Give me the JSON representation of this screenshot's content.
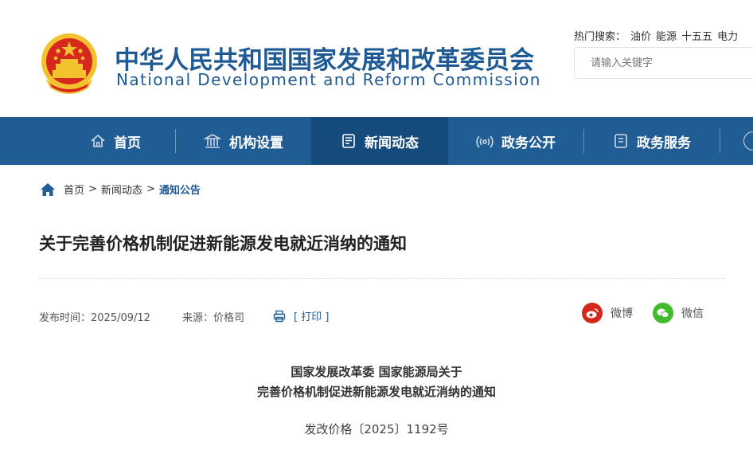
{
  "header": {
    "title_cn": "中华人民共和国国家发展和改革委员会",
    "title_en": "National Development and Reform Commission",
    "hot_search_label": "热门搜索：",
    "hot_keywords": [
      "油价",
      "能源",
      "十五五",
      "电力"
    ],
    "search_placeholder": "请输入关键字"
  },
  "nav": {
    "items": [
      {
        "label": "首页",
        "icon": "home-icon"
      },
      {
        "label": "机构设置",
        "icon": "institution-icon"
      },
      {
        "label": "新闻动态",
        "icon": "news-icon"
      },
      {
        "label": "政务公开",
        "icon": "broadcast-icon"
      },
      {
        "label": "政务服务",
        "icon": "service-icon"
      }
    ],
    "active_index": 2
  },
  "breadcrumb": {
    "items": [
      "首页",
      "新闻动态",
      "通知公告"
    ],
    "separator": ">"
  },
  "article": {
    "title": "关于完善价格机制促进新能源发电就近消纳的通知",
    "publish_time": "发布时间：2025/09/12",
    "source": "来源：价格司",
    "print_label": "[ 打印 ]",
    "share": {
      "weibo": "微博",
      "wechat": "微信"
    },
    "doc_issuer": "国家发展改革委 国家能源局关于",
    "doc_title": "完善价格机制促进新能源发电就近消纳的通知",
    "doc_number": "发改价格〔2025〕1192号"
  },
  "colors": {
    "brand_blue": "#1f5d94",
    "nav_active": "#154a7c",
    "weibo_red": "#d5261b",
    "wechat_green": "#3fbb2c"
  }
}
